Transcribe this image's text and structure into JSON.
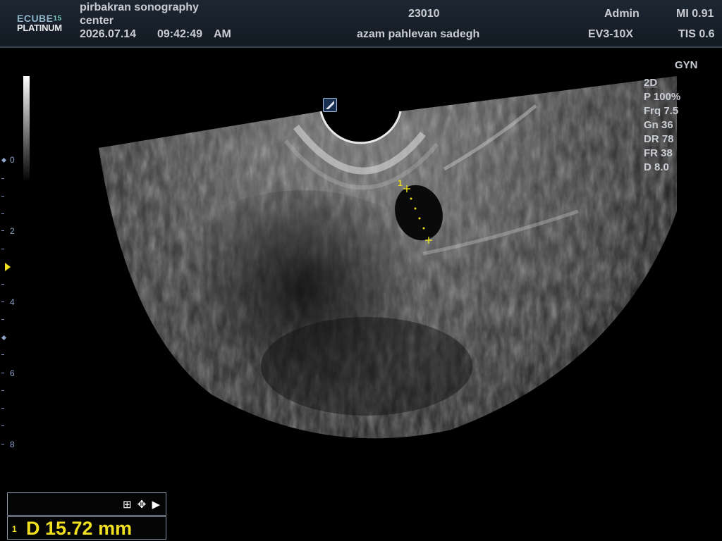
{
  "header": {
    "logo_top": "ECUBE",
    "logo_top_num": "15",
    "logo_bottom": "PLATINUM",
    "institution_line1": "pirbakran sonography",
    "institution_line2": "center",
    "date": "2026.07.14",
    "time": "09:42:49",
    "ampm": "AM",
    "patient_id": "23010",
    "patient_name": "azam pahlevan sadegh",
    "operator": "Admin",
    "probe": "EV3-10X",
    "mi": "MI 0.91",
    "tis": "TIS 0.6"
  },
  "preset": "GYN",
  "params": {
    "mode": "2D",
    "power": "P 100%",
    "frequency": "Frq 7.5",
    "gain": "Gn 36",
    "dynamic_range": "DR 78",
    "frame_rate": "FR 38",
    "depth": "D 8.0"
  },
  "depth_scale": {
    "labels": [
      "0",
      "2",
      "4",
      "6",
      "8"
    ],
    "grayscale_top": "#ffffff",
    "grayscale_bottom": "#000000",
    "focus_marker_color": "#f0e020"
  },
  "measurement": {
    "caliper_label": "1",
    "index": "1",
    "result": "D  15.72 mm",
    "color": "#f0e020"
  },
  "toolbar_icons": [
    "grid-icon",
    "move-icon",
    "play-icon"
  ],
  "icons": {
    "grid": "⊞",
    "move": "✥",
    "play": "▶"
  }
}
